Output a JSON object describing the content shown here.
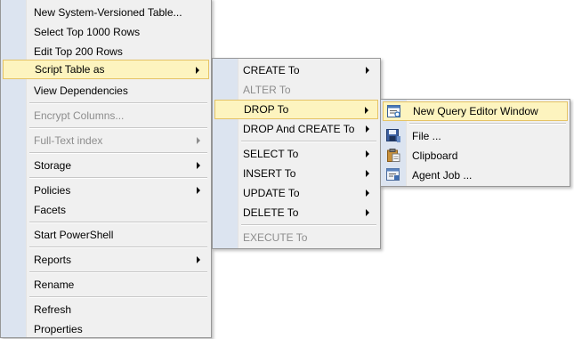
{
  "main_menu": {
    "items": [
      {
        "label": "New System-Versioned Table..."
      },
      {
        "label": "Select Top 1000 Rows"
      },
      {
        "label": "Edit Top 200 Rows"
      },
      {
        "label": "Script Table as"
      },
      {
        "label": "View Dependencies"
      },
      {
        "label": "Encrypt Columns..."
      },
      {
        "label": "Full-Text index"
      },
      {
        "label": "Storage"
      },
      {
        "label": "Policies"
      },
      {
        "label": "Facets"
      },
      {
        "label": "Start PowerShell"
      },
      {
        "label": "Reports"
      },
      {
        "label": "Rename"
      },
      {
        "label": "Refresh"
      },
      {
        "label": "Properties"
      }
    ]
  },
  "script_menu": {
    "items": [
      {
        "label": "CREATE To"
      },
      {
        "label": "ALTER To"
      },
      {
        "label": "DROP To"
      },
      {
        "label": "DROP And CREATE To"
      },
      {
        "label": "SELECT To"
      },
      {
        "label": "INSERT To"
      },
      {
        "label": "UPDATE To"
      },
      {
        "label": "DELETE To"
      },
      {
        "label": "EXECUTE To"
      }
    ]
  },
  "drop_menu": {
    "items": [
      {
        "label": "New Query Editor Window",
        "icon": "query-window-icon"
      },
      {
        "label": "File ...",
        "icon": "save-disk-icon"
      },
      {
        "label": "Clipboard",
        "icon": "clipboard-icon"
      },
      {
        "label": "Agent Job ...",
        "icon": "agent-job-icon"
      }
    ]
  },
  "colors": {
    "highlight_bg": "#fdf4bf",
    "highlight_border": "#e5c365",
    "gutter": "#dce4f0",
    "menu_bg": "#f0f0f0",
    "disabled_text": "#8d8d8d"
  }
}
